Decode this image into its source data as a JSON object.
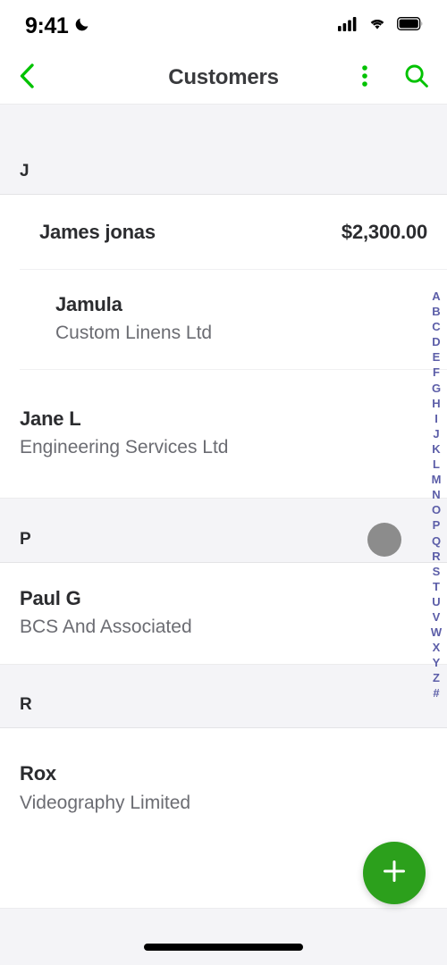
{
  "status_bar": {
    "time": "9:41",
    "dnd_icon": "moon-icon",
    "signal_icon": "cellular-signal-icon",
    "wifi_icon": "wifi-icon",
    "battery_icon": "battery-full-icon"
  },
  "nav": {
    "back_icon": "chevron-left-icon",
    "title": "Customers",
    "overflow_icon": "more-vertical-icon",
    "search_icon": "search-icon",
    "accent_color": "#00c200"
  },
  "list": {
    "sections": [
      {
        "letter": "J",
        "rows": [
          {
            "name": "James jonas",
            "subtitle": "",
            "amount": "$2,300.00",
            "indent": false
          },
          {
            "name": "Jamula",
            "subtitle": "Custom Linens Ltd",
            "amount": "",
            "indent": true
          },
          {
            "name": "Jane L",
            "subtitle": "Engineering Services Ltd",
            "amount": "",
            "indent": false
          }
        ]
      },
      {
        "letter": "P",
        "rows": [
          {
            "name": "Paul G",
            "subtitle": "BCS And Associated",
            "amount": "",
            "indent": false
          }
        ]
      },
      {
        "letter": "R",
        "rows": [
          {
            "name": "Rox",
            "subtitle": "Videography Limited",
            "amount": "",
            "indent": false
          }
        ]
      }
    ]
  },
  "alpha_index": {
    "color": "#5c5ea8",
    "items": [
      "A",
      "B",
      "C",
      "D",
      "E",
      "F",
      "G",
      "H",
      "I",
      "J",
      "K",
      "L",
      "M",
      "N",
      "O",
      "P",
      "Q",
      "R",
      "S",
      "T",
      "U",
      "V",
      "W",
      "X",
      "Y",
      "Z",
      "#"
    ]
  },
  "fab": {
    "icon": "plus-icon",
    "color": "#2ca01c"
  },
  "cursor": {
    "color": "#8c8c8c"
  },
  "bottom": {
    "home_indicator": "home-indicator"
  }
}
